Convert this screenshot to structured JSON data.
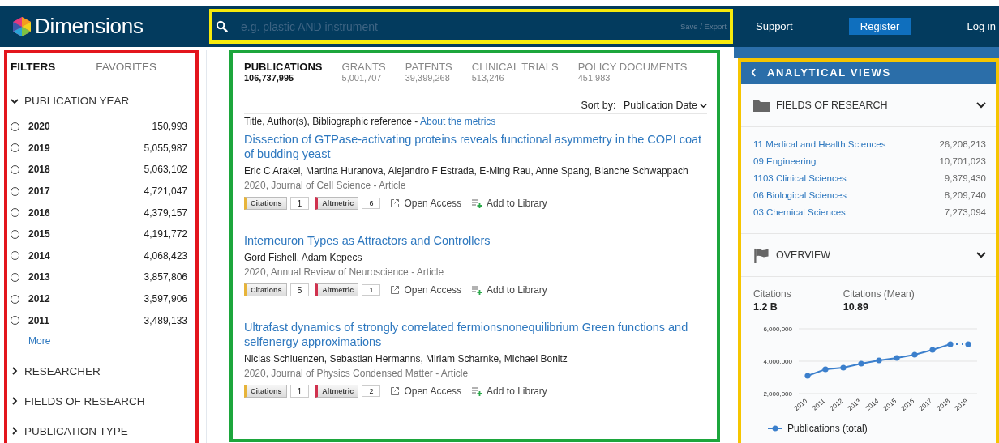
{
  "header": {
    "logo_text": "Dimensions",
    "search": {
      "placeholder": "e.g. plastic AND instrument"
    },
    "save_export": "Save / Export",
    "nav": [
      {
        "label": "Support",
        "kind": "link"
      },
      {
        "label": "Register",
        "kind": "button"
      },
      {
        "label": "Log in",
        "kind": "link"
      }
    ]
  },
  "filters": {
    "tabs": [
      {
        "label": "FILTERS",
        "selected": true
      },
      {
        "label": "FAVORITES",
        "selected": false
      }
    ],
    "sections": [
      {
        "label": "PUBLICATION YEAR",
        "expanded": true,
        "more": "More",
        "options": [
          {
            "label": "2020",
            "count": "150,993",
            "selected": false
          },
          {
            "label": "2019",
            "count": "5,055,987",
            "selected": false
          },
          {
            "label": "2018",
            "count": "5,063,102",
            "selected": false
          },
          {
            "label": "2017",
            "count": "4,721,047",
            "selected": false
          },
          {
            "label": "2016",
            "count": "4,379,157",
            "selected": false
          },
          {
            "label": "2015",
            "count": "4,191,772",
            "selected": false
          },
          {
            "label": "2014",
            "count": "4,068,423",
            "selected": false
          },
          {
            "label": "2013",
            "count": "3,857,806",
            "selected": false
          },
          {
            "label": "2012",
            "count": "3,597,906",
            "selected": false
          },
          {
            "label": "2011",
            "count": "3,489,133",
            "selected": false
          }
        ]
      },
      {
        "label": "RESEARCHER",
        "expanded": false
      },
      {
        "label": "FIELDS OF RESEARCH",
        "expanded": false
      },
      {
        "label": "PUBLICATION TYPE",
        "expanded": false
      }
    ]
  },
  "results": {
    "tabs": [
      {
        "label": "PUBLICATIONS",
        "count": "106,737,995",
        "selected": true
      },
      {
        "label": "GRANTS",
        "count": "5,001,707",
        "selected": false
      },
      {
        "label": "PATENTS",
        "count": "39,399,268",
        "selected": false
      },
      {
        "label": "CLINICAL TRIALS",
        "count": "513,246",
        "selected": false
      },
      {
        "label": "POLICY DOCUMENTS",
        "count": "451,983",
        "selected": false
      }
    ],
    "sort": {
      "label": "Sort by:",
      "value": "Publication Date"
    },
    "columns_note": "Title, Author(s), Bibliographic reference - ",
    "metrics_link": "About the metrics",
    "items": [
      {
        "title": "Dissection of GTPase-activating proteins reveals functional asymmetry in the COPI coat of budding yeast",
        "authors": "Eric C Arakel, Martina Huranova, Alejandro F Estrada, E-Ming Rau, Anne Spang, Blanche Schwappach",
        "reference": "2020, Journal of Cell Science - Article",
        "citations_label": "Citations",
        "citations": "1",
        "altmetric_label": "Altmetric",
        "altmetric": "6",
        "open_access": "Open Access",
        "add_to_library": "Add to Library"
      },
      {
        "title": "Interneuron Types as Attractors and Controllers",
        "authors": "Gord Fishell, Adam Kepecs",
        "reference": "2020, Annual Review of Neuroscience - Article",
        "citations_label": "Citations",
        "citations": "5",
        "altmetric_label": "Altmetric",
        "altmetric": "1",
        "open_access": "Open Access",
        "add_to_library": "Add to Library"
      },
      {
        "title": "Ultrafast dynamics of strongly correlated fermionsnonequilibrium Green functions and selfenergy approximations",
        "authors": "Niclas Schluenzen, Sebastian Hermanns, Miriam Scharnke, Michael Bonitz",
        "reference": "2020, Journal of Physics Condensed Matter - Article",
        "citations_label": "Citations",
        "citations": "1",
        "altmetric_label": "Altmetric",
        "altmetric": "2",
        "open_access": "Open Access",
        "add_to_library": "Add to Library"
      }
    ]
  },
  "analytics": {
    "title": "ANALYTICAL VIEWS",
    "fields": {
      "title": "FIELDS OF RESEARCH",
      "items": [
        {
          "label": "11 Medical and Health Sciences",
          "count": "26,208,213"
        },
        {
          "label": "09 Engineering",
          "count": "10,701,023"
        },
        {
          "label": "1103 Clinical Sciences",
          "count": "9,379,430"
        },
        {
          "label": "06 Biological Sciences",
          "count": "8,209,740"
        },
        {
          "label": "03 Chemical Sciences",
          "count": "7,273,094"
        }
      ]
    },
    "overview": {
      "title": "OVERVIEW",
      "stats": [
        {
          "label": "Citations",
          "value": "1.2 B"
        },
        {
          "label": "Citations (Mean)",
          "value": "10.89"
        }
      ],
      "chart_data": {
        "type": "line",
        "categories": [
          "2010",
          "2011",
          "2012",
          "2013",
          "2014",
          "2015",
          "2016",
          "2017",
          "2018",
          "2019"
        ],
        "series": [
          {
            "name": "Publications (total)",
            "color": "#3b7fcc",
            "marker": true,
            "values": [
              3100000,
              3500000,
              3600000,
              3850000,
              4050000,
              4200000,
              4400000,
              4700000,
              5050000,
              5050000
            ]
          }
        ],
        "ylim": [
          2000000,
          6000000
        ],
        "yticks": [
          {
            "value": 2000000,
            "label": "2,000,000"
          },
          {
            "value": 4000000,
            "label": "4,000,000"
          },
          {
            "value": 6000000,
            "label": "6,000,000"
          }
        ]
      }
    }
  }
}
